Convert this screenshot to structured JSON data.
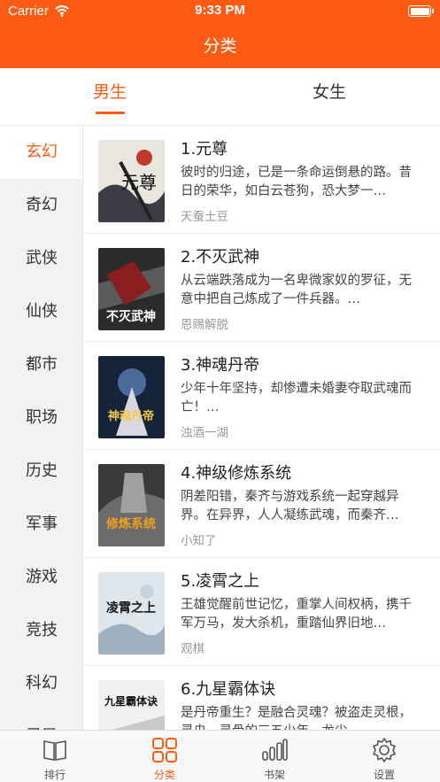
{
  "status_bar": {
    "carrier": "Carrier",
    "time": "9:33 PM"
  },
  "nav": {
    "title": "分类"
  },
  "gender_tabs": [
    {
      "label": "男生",
      "selected": true
    },
    {
      "label": "女生",
      "selected": false
    }
  ],
  "categories": [
    {
      "label": "玄幻",
      "selected": true
    },
    {
      "label": "奇幻"
    },
    {
      "label": "武侠"
    },
    {
      "label": "仙侠"
    },
    {
      "label": "都市"
    },
    {
      "label": "职场"
    },
    {
      "label": "历史"
    },
    {
      "label": "军事"
    },
    {
      "label": "游戏"
    },
    {
      "label": "竞技"
    },
    {
      "label": "科幻"
    },
    {
      "label": "灵异"
    }
  ],
  "books": [
    {
      "title": "1.元尊",
      "desc": "彼时的归途，已是一条命运倒悬的路。昔日的荣华，如白云苍狗，恐大梦一…",
      "author": "天蚕土豆",
      "cover_text": "元尊"
    },
    {
      "title": "2.不灭武神",
      "desc": "从云端跌落成为一名卑微家奴的罗征，无意中把自己炼成了一件兵器。…",
      "author": "恩赐解脱",
      "cover_text": "不灭武神"
    },
    {
      "title": "3.神魂丹帝",
      "desc": "少年十年坚持，却惨遭未婚妻夺取武魂而亡！…",
      "author": "浊酒一湖",
      "cover_text": "神魂丹帝"
    },
    {
      "title": "4.神级修炼系统",
      "desc": "阴差阳错，秦齐与游戏系统一起穿越异界。在异界，人人凝练武魂，而秦齐…",
      "author": "小知了",
      "cover_text": "修炼系统"
    },
    {
      "title": "5.凌霄之上",
      "desc": "王雄觉醒前世记忆，重掌人间权柄，携千军万马，发大杀机，重踏仙界旧地…",
      "author": "观棋",
      "cover_text": "凌霄之上"
    },
    {
      "title": "6.九星霸体诀",
      "desc": "是丹帝重生？是融合灵魂？被盗走灵根，灵央，灵骨的三五少年，龙尘…",
      "author": "",
      "cover_text": "九星霸体诀"
    }
  ],
  "tab_bar": [
    {
      "label": "排行",
      "icon": "book-open-icon",
      "selected": false
    },
    {
      "label": "分类",
      "icon": "grid-icon",
      "selected": true
    },
    {
      "label": "书架",
      "icon": "bars-icon",
      "selected": false
    },
    {
      "label": "设置",
      "icon": "gear-icon",
      "selected": false
    }
  ],
  "colors": {
    "accent": "#FD5A13",
    "sidebar_bg": "#F2F2F2",
    "text": "#333333",
    "muted": "#999999"
  }
}
